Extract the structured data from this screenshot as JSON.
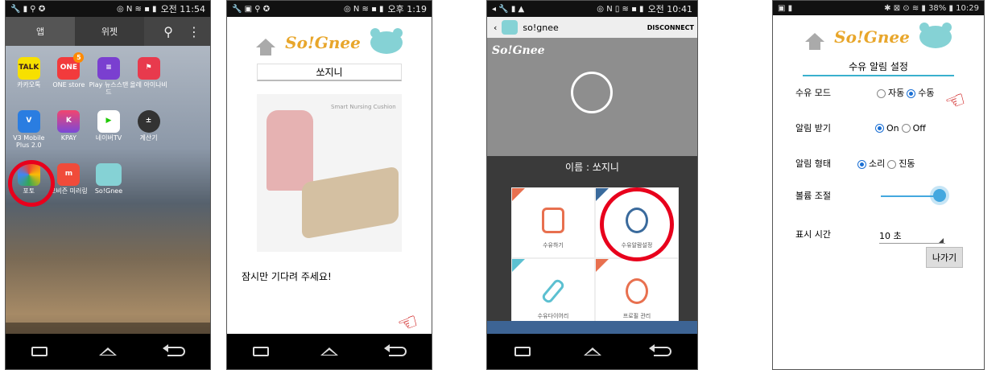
{
  "phone1": {
    "status": {
      "time": "오전 11:54"
    },
    "tabs": {
      "apps": "앱",
      "widgets": "위젯"
    },
    "apps": [
      "카카오톡",
      "ONE store",
      "Play 뉴스스탠드",
      "올레 아이나비",
      "V3 Mobile Plus 2.0",
      "KPAY",
      "네이버TV",
      "계산기",
      "포토",
      "모비즌 미러링"
    ],
    "app_icons": {
      "kakao": "TALK",
      "one": "ONE",
      "one_badge": "5",
      "kpay": "K",
      "mobizen": "m"
    },
    "solgnee_app": "So!Gnee"
  },
  "phone2": {
    "status": {
      "time": "오후 1:19"
    },
    "logo": "So!Gnee",
    "title": "쏘지니",
    "product_caption": "Smart Nursing Cushion",
    "wait_msg": "잠시만 기다려 주세요!"
  },
  "phone3": {
    "status": {
      "time": "오전 10:41"
    },
    "app_title": "so!gnee",
    "disconnect": "DISCONNECT",
    "logo": "So!Gnee",
    "name_label": "이름 :",
    "name_value": "쏘지니",
    "cards": [
      "수유하기",
      "수유알람설정",
      "수유다이어리",
      "프로필 관리"
    ]
  },
  "phone4": {
    "status": {
      "battery": "38%",
      "time": "10:29"
    },
    "logo": "So!Gnee",
    "title": "수유 알림 설정",
    "mode_label": "수유 모드",
    "mode_auto": "자동",
    "mode_manual": "수동",
    "alert_label": "알림 받기",
    "alert_on": "On",
    "alert_off": "Off",
    "type_label": "알림 형태",
    "type_sound": "소리",
    "type_vibe": "진동",
    "volume_label": "볼륨 조절",
    "volume_level": 0.85,
    "time_label": "표시 시간",
    "time_value": "10 초",
    "exit_button": "나가기"
  },
  "colors": {
    "logo": "#e8a62b",
    "accent": "#3ab0ce",
    "radio": "#1a6fd4",
    "highlight": "#e8001c"
  }
}
